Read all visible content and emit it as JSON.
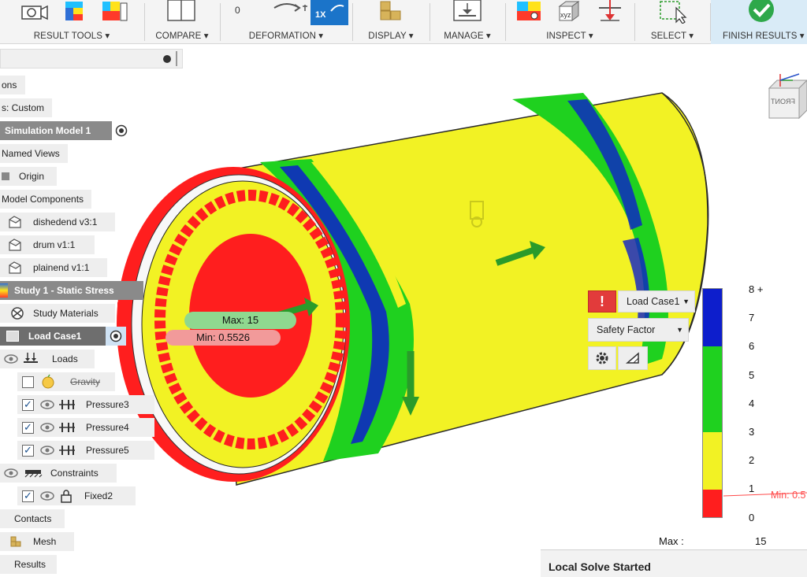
{
  "toolbar": {
    "groups": [
      {
        "label": "RESULT TOOLS ▾"
      },
      {
        "label": "COMPARE ▾"
      },
      {
        "label": "DEFORMATION ▾"
      },
      {
        "label": "DISPLAY ▾"
      },
      {
        "label": "MANAGE ▾"
      },
      {
        "label": "INSPECT ▾"
      },
      {
        "label": "SELECT ▾"
      },
      {
        "label": "FINISH RESULTS ▾"
      }
    ],
    "deformation_value": "0",
    "deformation_scale": "1X"
  },
  "browser": {
    "items": [
      {
        "label": "ons"
      },
      {
        "label": "s: Custom"
      },
      {
        "label": "Simulation Model 1"
      },
      {
        "label": "Named Views"
      },
      {
        "label": "Origin"
      },
      {
        "label": "Model Components"
      },
      {
        "label": "dishedend v3:1"
      },
      {
        "label": "drum v1:1"
      },
      {
        "label": "plainend v1:1"
      },
      {
        "label": "Study 1 - Static Stress"
      },
      {
        "label": "Study Materials"
      },
      {
        "label": "Load Case1"
      },
      {
        "label": "Loads"
      },
      {
        "label": "Gravity"
      },
      {
        "label": "Pressure3"
      },
      {
        "label": "Pressure4"
      },
      {
        "label": "Pressure5"
      },
      {
        "label": "Constraints"
      },
      {
        "label": "Fixed2"
      },
      {
        "label": "Contacts"
      },
      {
        "label": "Mesh"
      },
      {
        "label": "Results"
      }
    ]
  },
  "viewport": {
    "max_probe": "Max: 15",
    "min_probe": "Min: 0.5526",
    "viewcube_label": "FRONT",
    "legend_min_marker": "Min: 0.5",
    "colors": {
      "yellow": "#f2f224",
      "green": "#1fd11f",
      "blue": "#0d1ecc",
      "red": "#ff1e1e"
    }
  },
  "results_panel": {
    "load_case": "Load Case1",
    "result_type": "Safety Factor"
  },
  "legend": {
    "ticks": [
      "8 +",
      "7",
      "6",
      "5",
      "4",
      "3",
      "2",
      "1",
      "0"
    ],
    "max_label": "Max :",
    "max_value": "15"
  },
  "status": {
    "message": "Local Solve Started"
  }
}
